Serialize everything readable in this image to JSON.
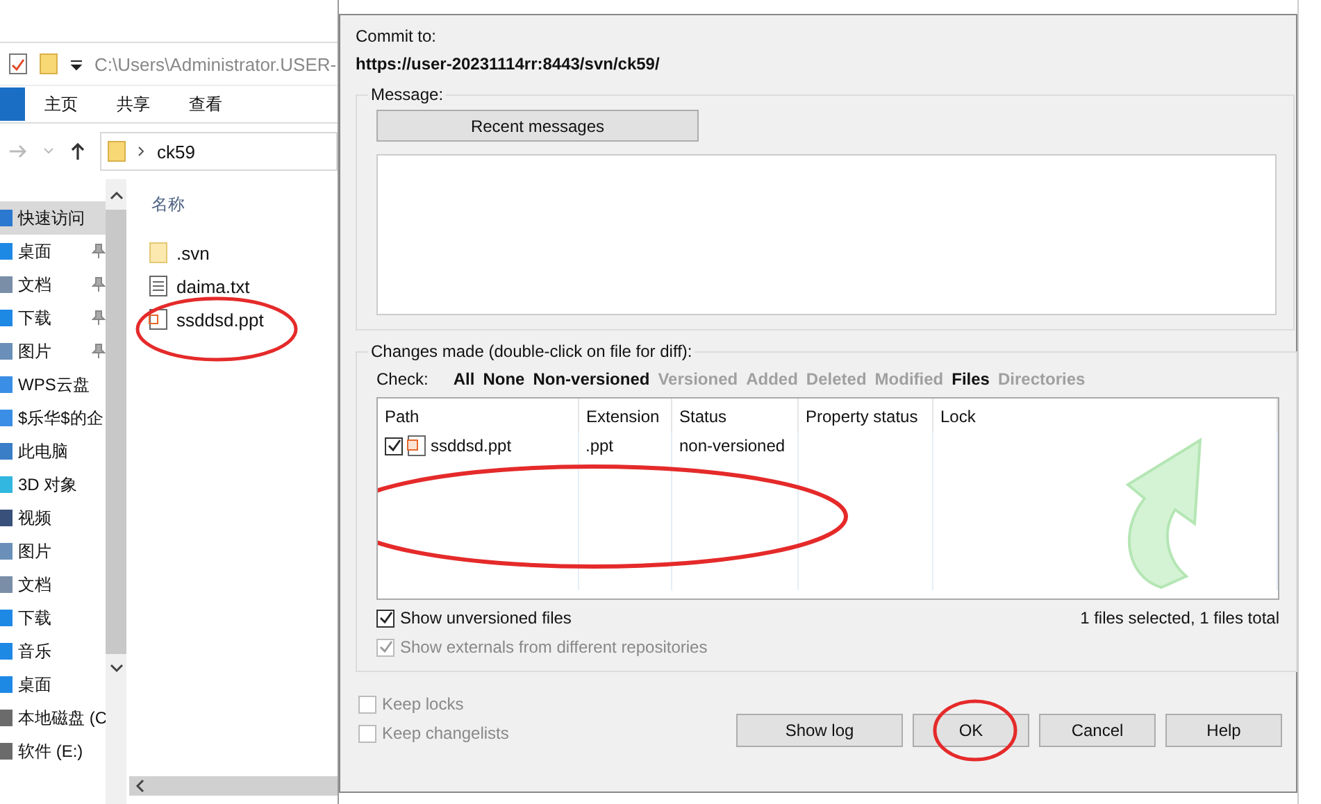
{
  "explorer": {
    "address_path": "C:\\Users\\Administrator.USER-",
    "ribbon_tabs": [
      {
        "label": "主页",
        "selected": false
      },
      {
        "label": "共享",
        "selected": false
      },
      {
        "label": "查看",
        "selected": false
      }
    ],
    "breadcrumb": "ck59",
    "nav_items": [
      {
        "label": "快速访问",
        "kind": "star",
        "pinned": false,
        "selected": true
      },
      {
        "label": "桌面",
        "kind": "desktop",
        "pinned": true,
        "selected": false
      },
      {
        "label": "文档",
        "kind": "doc",
        "pinned": true,
        "selected": false
      },
      {
        "label": "下载",
        "kind": "download",
        "pinned": true,
        "selected": false
      },
      {
        "label": "图片",
        "kind": "picture",
        "pinned": true,
        "selected": false
      },
      {
        "label": "WPS云盘",
        "kind": "cloud",
        "pinned": false,
        "selected": false
      },
      {
        "label": "$乐华$的企",
        "kind": "cloud",
        "pinned": false,
        "selected": false
      },
      {
        "label": "此电脑",
        "kind": "pc",
        "pinned": false,
        "selected": false
      },
      {
        "label": "3D 对象",
        "kind": "cube",
        "pinned": false,
        "selected": false
      },
      {
        "label": "视频",
        "kind": "video",
        "pinned": false,
        "selected": false
      },
      {
        "label": "图片",
        "kind": "picture",
        "pinned": false,
        "selected": false
      },
      {
        "label": "文档",
        "kind": "doc",
        "pinned": false,
        "selected": false
      },
      {
        "label": "下载",
        "kind": "download",
        "pinned": false,
        "selected": false
      },
      {
        "label": "音乐",
        "kind": "music",
        "pinned": false,
        "selected": false
      },
      {
        "label": "桌面",
        "kind": "desktop",
        "pinned": false,
        "selected": false
      },
      {
        "label": "本地磁盘 (C",
        "kind": "drive",
        "pinned": false,
        "selected": false
      },
      {
        "label": "软件 (E:)",
        "kind": "drive",
        "pinned": false,
        "selected": false
      }
    ],
    "column_header": "名称",
    "files": [
      {
        "name": ".svn",
        "kind": "folder"
      },
      {
        "name": "daima.txt",
        "kind": "text"
      },
      {
        "name": "ssddsd.ppt",
        "kind": "ppt"
      }
    ]
  },
  "dialog": {
    "commit_label": "Commit to:",
    "commit_url": "https://user-20231114rr:8443/svn/ck59/",
    "message_group": "Message:",
    "recent_button": "Recent messages",
    "changes_group": "Changes made (double-click on file for diff):",
    "check_label": "Check:",
    "check_filters": [
      {
        "label": "All",
        "enabled": true
      },
      {
        "label": "None",
        "enabled": true
      },
      {
        "label": "Non-versioned",
        "enabled": true
      },
      {
        "label": "Versioned",
        "enabled": false
      },
      {
        "label": "Added",
        "enabled": false
      },
      {
        "label": "Deleted",
        "enabled": false
      },
      {
        "label": "Modified",
        "enabled": false
      },
      {
        "label": "Files",
        "enabled": true
      },
      {
        "label": "Directories",
        "enabled": false
      }
    ],
    "columns": [
      "Path",
      "Extension",
      "Status",
      "Property status",
      "Lock"
    ],
    "rows": [
      {
        "checked": true,
        "path": "ssddsd.ppt",
        "extension": ".ppt",
        "status": "non-versioned",
        "property_status": "",
        "lock": ""
      }
    ],
    "options": [
      {
        "label": "Show unversioned files",
        "checked": true,
        "disabled": false
      },
      {
        "label": "Show externals from different repositories",
        "checked": true,
        "disabled": true
      }
    ],
    "summary": "1 files selected, 1 files total",
    "keep_options": [
      {
        "label": "Keep locks",
        "checked": false,
        "disabled": true
      },
      {
        "label": "Keep changelists",
        "checked": false,
        "disabled": true
      }
    ],
    "buttons": [
      "Show log",
      "OK",
      "Cancel",
      "Help"
    ]
  }
}
